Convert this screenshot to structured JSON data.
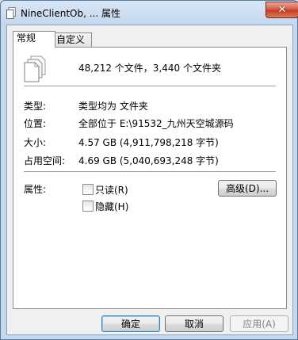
{
  "window": {
    "title": "NineClientOb, ... 属性",
    "close_glyph": "✕"
  },
  "tabs": [
    {
      "label": "常规"
    },
    {
      "label": "自定义"
    }
  ],
  "summary": {
    "text": "48,212 个文件，3,440 个文件夹"
  },
  "rows": {
    "type": {
      "label": "类型:",
      "value": "类型均为 文件夹"
    },
    "location": {
      "label": "位置:",
      "value": "全部位于 E:\\91532_九州天空城源码"
    },
    "size": {
      "label": "大小:",
      "value": "4.57 GB (4,911,798,218 字节)"
    },
    "disk_size": {
      "label": "占用空间:",
      "value": "4.69 GB (5,040,693,248 字节)"
    }
  },
  "attributes": {
    "label": "属性:",
    "readonly": {
      "label": "只读(R)",
      "checked": false
    },
    "hidden": {
      "label": "隐藏(H)",
      "checked": false
    },
    "advanced_button": "高级(D)..."
  },
  "buttons": {
    "ok": "确定",
    "cancel": "取消",
    "apply": "应用(A)"
  },
  "colors": {
    "close_button": "#c23b22",
    "title_gradient_top": "#d9e7f6",
    "default_button_border": "#3c7fb1"
  }
}
